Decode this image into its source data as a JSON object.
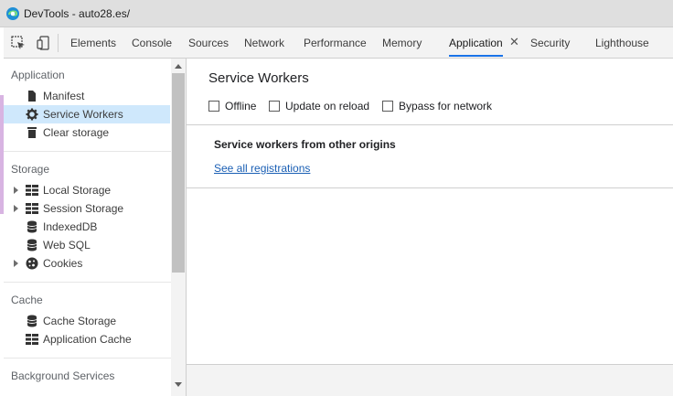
{
  "window": {
    "title": "DevTools - auto28.es/"
  },
  "toolbar": {
    "inspect_icon": "inspect-element-icon",
    "device_icon": "device-toolbar-icon"
  },
  "tabs": [
    {
      "label": "Elements"
    },
    {
      "label": "Console"
    },
    {
      "label": "Sources"
    },
    {
      "label": "Network"
    },
    {
      "label": "Performance"
    },
    {
      "label": "Memory"
    },
    {
      "label": "Application",
      "active": true
    },
    {
      "label": "Security"
    },
    {
      "label": "Lighthouse"
    }
  ],
  "tab_close": "✕",
  "sidebar": {
    "application": {
      "title": "Application",
      "items": [
        {
          "label": "Manifest",
          "icon": "file-icon"
        },
        {
          "label": "Service Workers",
          "icon": "gear-icon",
          "selected": true
        },
        {
          "label": "Clear storage",
          "icon": "trash-icon"
        }
      ]
    },
    "storage": {
      "title": "Storage",
      "items": [
        {
          "label": "Local Storage",
          "icon": "grid-icon",
          "expandable": true
        },
        {
          "label": "Session Storage",
          "icon": "grid-icon",
          "expandable": true
        },
        {
          "label": "IndexedDB",
          "icon": "database-icon"
        },
        {
          "label": "Web SQL",
          "icon": "database-icon"
        },
        {
          "label": "Cookies",
          "icon": "cookie-icon",
          "expandable": true
        }
      ]
    },
    "cache": {
      "title": "Cache",
      "items": [
        {
          "label": "Cache Storage",
          "icon": "database-icon"
        },
        {
          "label": "Application Cache",
          "icon": "grid-icon"
        }
      ]
    },
    "background": {
      "title": "Background Services"
    }
  },
  "main": {
    "title": "Service Workers",
    "options": [
      {
        "label": "Offline",
        "checked": false
      },
      {
        "label": "Update on reload",
        "checked": false
      },
      {
        "label": "Bypass for network",
        "checked": false
      }
    ],
    "other_origins_title": "Service workers from other origins",
    "see_all_link": "See all registrations"
  },
  "colors": {
    "accent": "#1a73e8",
    "selection": "#cfe8fc",
    "link": "#1a5fb4"
  }
}
